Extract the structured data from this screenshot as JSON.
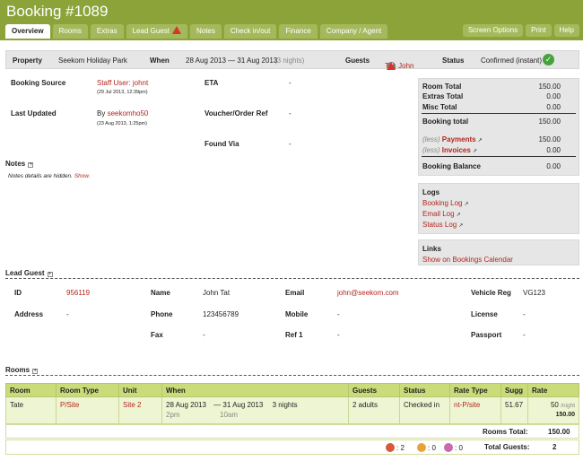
{
  "header": {
    "title": "Booking #1089"
  },
  "tabs": [
    {
      "label": "Overview",
      "active": true
    },
    {
      "label": "Rooms"
    },
    {
      "label": "Extras"
    },
    {
      "label": "Lead Guest",
      "warning": true
    },
    {
      "label": "Notes"
    },
    {
      "label": "Check in/out"
    },
    {
      "label": "Finance"
    },
    {
      "label": "Company / Agent"
    }
  ],
  "right_buttons": [
    "Screen Options",
    "Print",
    "Help"
  ],
  "summary": {
    "property_label": "Property",
    "property_value": "Seekom Holiday Park",
    "when_label": "When",
    "when_value": "28 Aug 2013 — 31 Aug 2013",
    "when_nights": "(3 nights)",
    "guests_label": "Guests",
    "guests_value": "Tat, John",
    "guests_badge": "2",
    "status_label": "Status",
    "status_value": "Confirmed (instant)"
  },
  "booking": {
    "source_label": "Booking Source",
    "source_value": "Staff User: johnt",
    "source_date": "(29 Jul 2013, 12:39pm)",
    "updated_label": "Last Updated",
    "updated_value": "By seekomho50",
    "updated_date": "(23 Aug 2013, 1:25pm)",
    "eta_label": "ETA",
    "eta_value": "-",
    "voucher_label": "Voucher/Order Ref",
    "voucher_value": "-",
    "found_label": "Found Via",
    "found_value": "-"
  },
  "notes": {
    "heading": "Notes",
    "text": "Notes details are hidden.",
    "show": "Show."
  },
  "totals": {
    "room_total_label": "Room Total",
    "room_total": "150.00",
    "extras_label": "Extras Total",
    "extras": "0.00",
    "misc_label": "Misc Total",
    "misc": "0.00",
    "booking_total_label": "Booking total",
    "booking_total": "150.00",
    "less": "(less)",
    "payments_label": "Payments",
    "payments": "150.00",
    "invoices_label": "Invoices",
    "invoices": "0.00",
    "balance_label": "Booking Balance",
    "balance": "0.00"
  },
  "logs": {
    "heading": "Logs",
    "items": [
      "Booking Log",
      "Email Log",
      "Status Log"
    ]
  },
  "links": {
    "heading": "Links",
    "calendar": "Show on Bookings Calendar"
  },
  "lead_guest": {
    "heading": "Lead Guest",
    "id_label": "ID",
    "id_value": "956119",
    "name_label": "Name",
    "name_value": "John Tat",
    "email_label": "Email",
    "email_value": "john@seekom.com",
    "vehicle_label": "Vehicle Reg",
    "vehicle_value": "VG123",
    "address_label": "Address",
    "address_value": "-",
    "phone_label": "Phone",
    "phone_value": "123456789",
    "mobile_label": "Mobile",
    "mobile_value": "-",
    "license_label": "License",
    "license_value": "-",
    "fax_label": "Fax",
    "fax_value": "-",
    "ref1_label": "Ref 1",
    "ref1_value": "-",
    "passport_label": "Passport",
    "passport_value": "-"
  },
  "rooms": {
    "heading": "Rooms",
    "columns": [
      "Room",
      "Room Type",
      "Unit",
      "When",
      "Guests",
      "Status",
      "Rate Type",
      "Sugg",
      "Rate"
    ],
    "row": {
      "room": "Tate",
      "room_type": "P/Site",
      "unit": "Site 2",
      "when_from": "28 Aug 2013",
      "when_sep": "— 31 Aug 2013",
      "nights": "3 nights",
      "time_from": "2pm",
      "time_to": "10am",
      "guests": "2 adults",
      "status": "Checked in",
      "rate_type": "nt-P/site",
      "sugg": "51.67",
      "rate": "50",
      "rate_unit": "/night",
      "rate_total": "150.00"
    },
    "total_label": "Rooms Total:",
    "total": "150.00",
    "adults": ": 2",
    "children": ": 0",
    "infants": ": 0",
    "guests_label": "Total Guests:",
    "guests_total": "2"
  },
  "colors": {
    "header": "#8ca33a",
    "link_red": "#b3261e",
    "table_header": "#cadc7a",
    "table_row": "#eef5d2"
  }
}
